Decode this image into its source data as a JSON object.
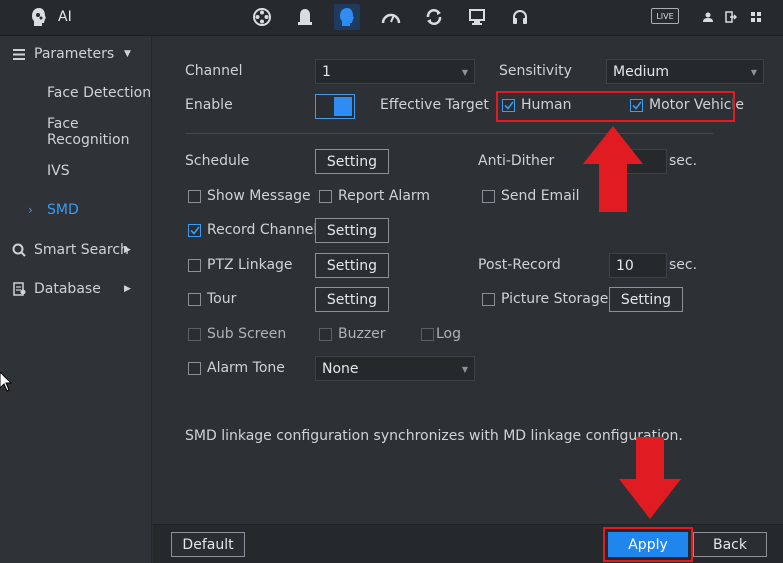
{
  "topbar": {
    "title": "AI",
    "icons": [
      "film-reel-icon",
      "alarm-bell-icon",
      "ai-head-icon",
      "dial-icon",
      "sync-icon",
      "monitor-icon",
      "headset-icon"
    ],
    "live_label": "LIVE"
  },
  "sidebar": {
    "parameters_label": "Parameters",
    "items": [
      "Face Detection",
      "Face Recognition",
      "IVS",
      "SMD"
    ],
    "selected_item": "SMD",
    "smart_search_label": "Smart Search",
    "database_label": "Database"
  },
  "form": {
    "channel_label": "Channel",
    "channel_value": "1",
    "sensitivity_label": "Sensitivity",
    "sensitivity_value": "Medium",
    "enable_label": "Enable",
    "enable_on": true,
    "effective_target_label": "Effective Target",
    "human_label": "Human",
    "human_checked": true,
    "motor_vehicle_label": "Motor Vehicle",
    "motor_vehicle_checked": true,
    "schedule_label": "Schedule",
    "setting_label": "Setting",
    "anti_dither_label": "Anti-Dither",
    "anti_dither_value": "",
    "sec_unit": "sec.",
    "show_message_label": "Show Message",
    "report_alarm_label": "Report Alarm",
    "send_email_label": "Send Email",
    "record_channel_label": "Record Channel",
    "record_channel_checked": true,
    "ptz_linkage_label": "PTZ Linkage",
    "post_record_label": "Post-Record",
    "post_record_value": "10",
    "tour_label": "Tour",
    "picture_storage_label": "Picture Storage",
    "sub_screen_label": "Sub Screen",
    "buzzer_label": "Buzzer",
    "log_label": "Log",
    "alarm_tone_label": "Alarm Tone",
    "alarm_tone_value": "None",
    "note": "SMD linkage configuration synchronizes with MD linkage configuration."
  },
  "footer": {
    "default_label": "Default",
    "apply_label": "Apply",
    "back_label": "Back"
  },
  "colors": {
    "accent": "#1f86ee",
    "highlight": "#e11b22",
    "background": "#2d3034"
  }
}
